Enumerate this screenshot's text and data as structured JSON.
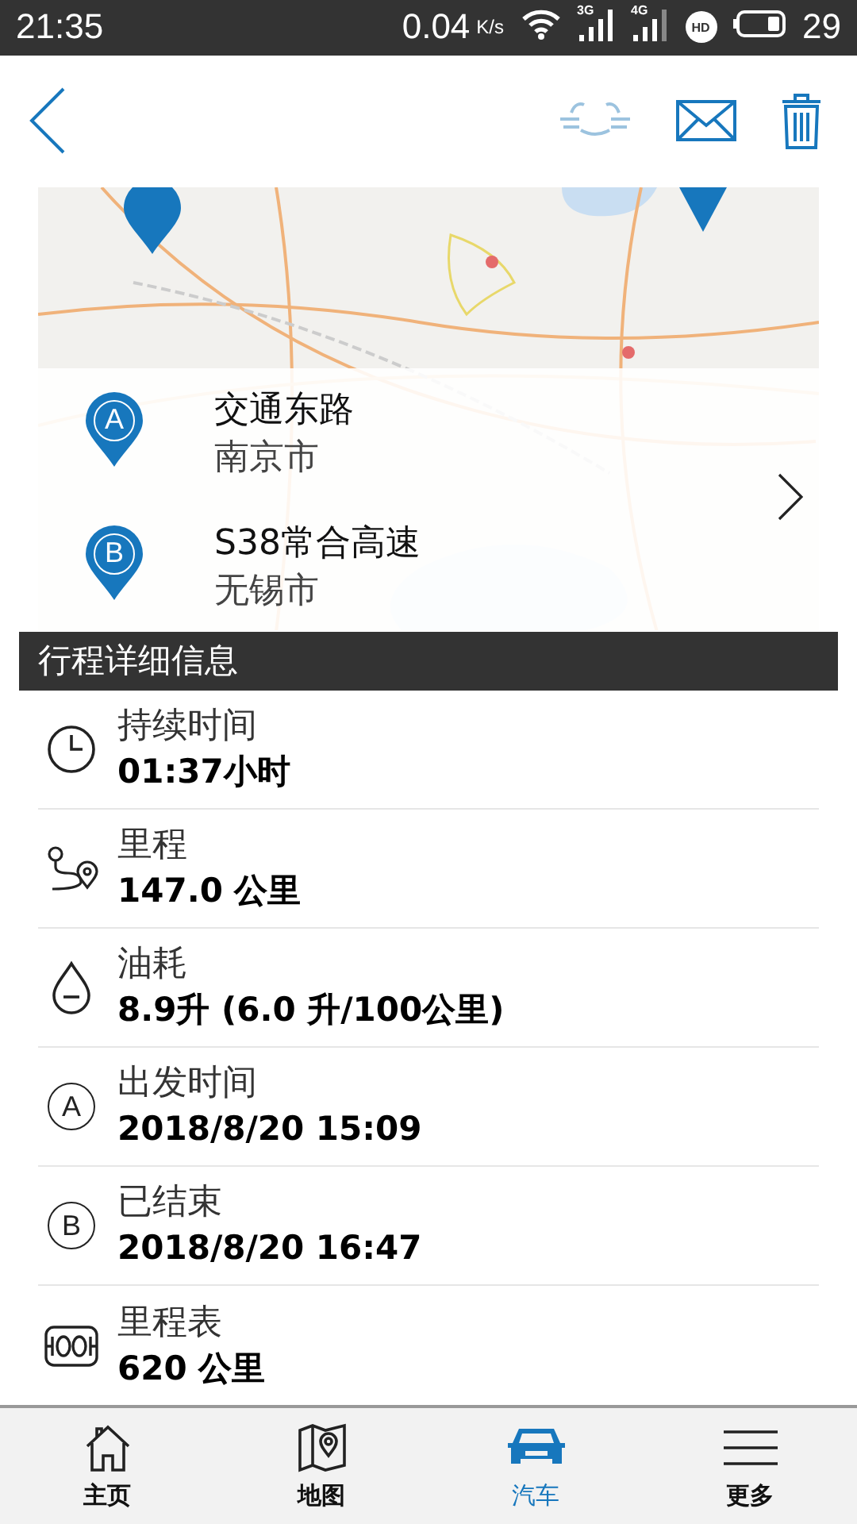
{
  "status_bar": {
    "time": "21:35",
    "speed": "0.04",
    "speed_unit": "K/s",
    "signal_labels": [
      "3G",
      "4G"
    ],
    "hd": "HD",
    "battery": "29"
  },
  "locations": [
    {
      "marker": "A",
      "title": "交通东路",
      "subtitle": "南京市"
    },
    {
      "marker": "B",
      "title": "S38常合高速",
      "subtitle": "无锡市"
    }
  ],
  "section_title": "行程详细信息",
  "details": [
    {
      "kind": "duration",
      "label": "持续时间",
      "value": "01:37小时"
    },
    {
      "kind": "distance",
      "label": "里程",
      "value": "147.0 公里"
    },
    {
      "kind": "fuel",
      "label": "油耗",
      "value": "8.9升 (6.0 升/100公里)"
    },
    {
      "kind": "marker",
      "marker": "A",
      "label": "出发时间",
      "value": "2018/8/20 15:09"
    },
    {
      "kind": "marker",
      "marker": "B",
      "label": "已结束",
      "value": "2018/8/20 16:47"
    },
    {
      "kind": "odometer",
      "label": "里程表",
      "value": "620 公里"
    }
  ],
  "nav": [
    {
      "kind": "home",
      "label": "主页",
      "selected": false
    },
    {
      "kind": "map",
      "label": "地图",
      "selected": false
    },
    {
      "kind": "car",
      "label": "汽车",
      "selected": true
    },
    {
      "kind": "menu",
      "label": "更多",
      "selected": false
    }
  ]
}
